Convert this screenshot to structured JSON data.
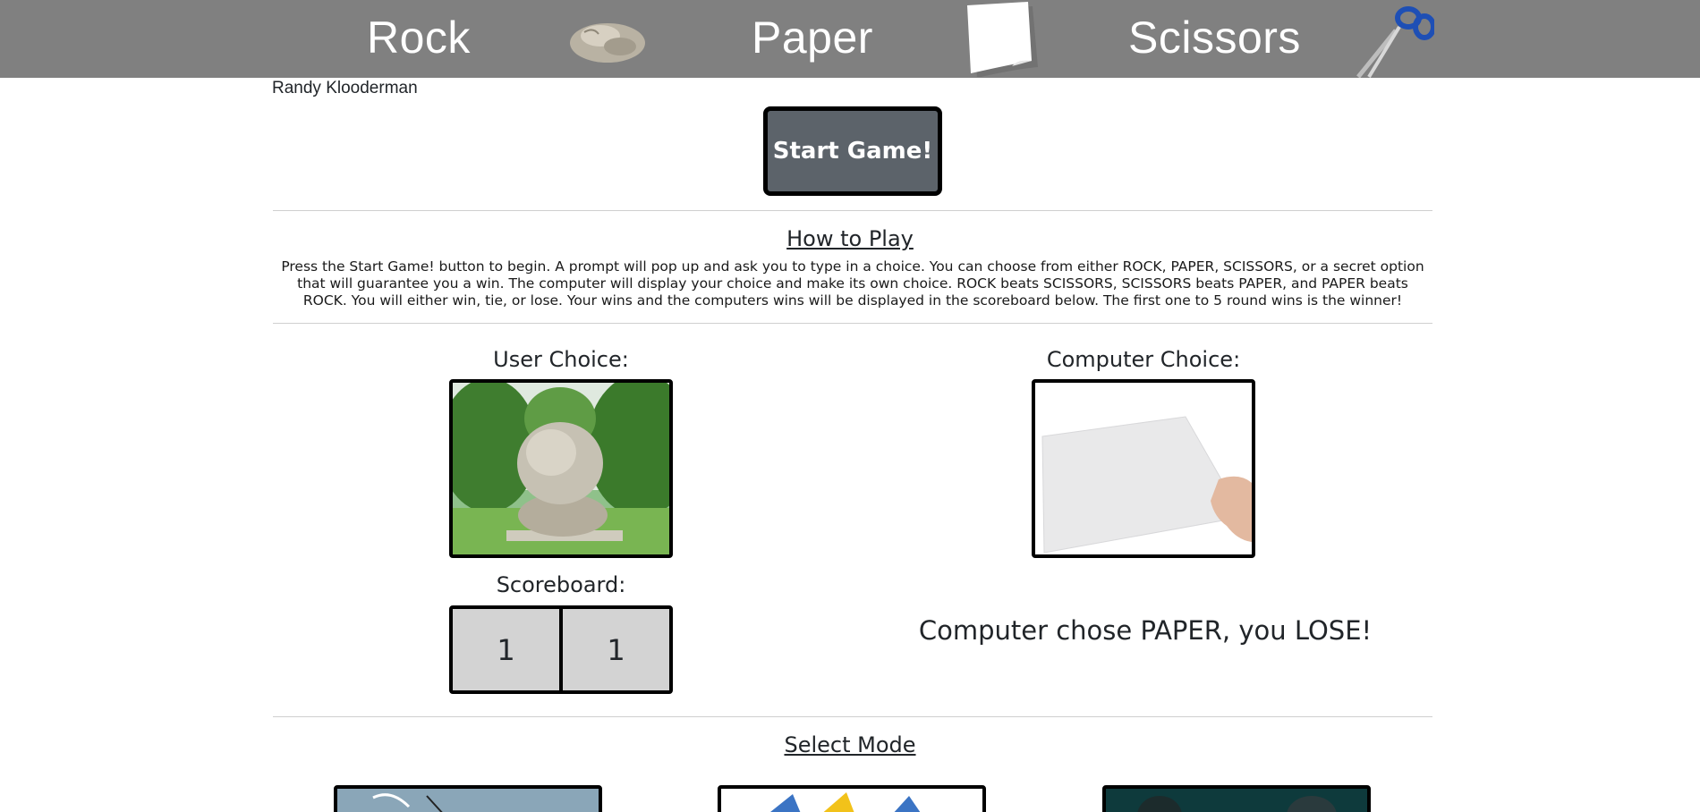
{
  "header": {
    "rock_label": "Rock",
    "paper_label": "Paper",
    "scissors_label": "Scissors",
    "rock_icon": "rock-icon",
    "paper_icon": "paper-icon",
    "scissors_icon": "scissors-icon",
    "background_color": "#808080"
  },
  "author": "Randy Klooderman",
  "start_button": {
    "label": "Start Game!",
    "color": "#5c636a"
  },
  "how_to_play": {
    "title": "How to Play",
    "text": "Press the Start Game! button to begin. A prompt will pop up and ask you to type in a choice. You can choose from either ROCK, PAPER, SCISSORS, or a secret option that will guarantee you a win. The computer will display your choice and make its own choice. ROCK beats SCISSORS, SCISSORS beats PAPER, and PAPER beats ROCK. You will either win, tie, or lose. Your wins and the computers wins will be displayed in the scoreboard below. The first one to 5 round wins is the winner!"
  },
  "user_choice": {
    "label": "User Choice:",
    "image": "rock-photo"
  },
  "computer_choice": {
    "label": "Computer Choice:",
    "image": "paper-photo"
  },
  "scoreboard": {
    "label": "Scoreboard:",
    "user_score": "1",
    "computer_score": "1"
  },
  "result": "Computer chose PAPER, you LOSE!",
  "select_mode": {
    "title": "Select Mode",
    "modes": [
      {
        "image": "mode-comic-image"
      },
      {
        "image": "mode-pokemon-image"
      },
      {
        "image": "mode-dark-image"
      }
    ]
  }
}
